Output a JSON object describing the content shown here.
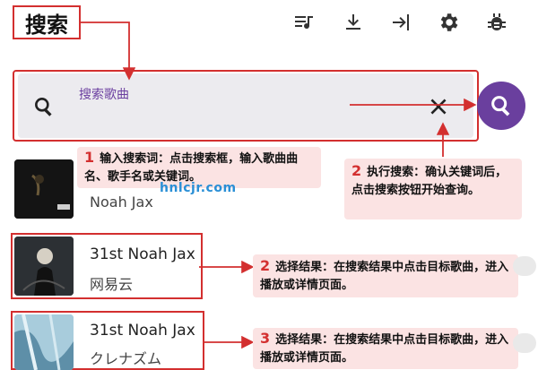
{
  "header": {
    "title": "搜索",
    "icons": [
      "playlist-icon",
      "download-icon",
      "login-icon",
      "gear-icon",
      "bug-icon"
    ]
  },
  "search": {
    "placeholder": "搜索歌曲"
  },
  "callouts": {
    "c1": {
      "num": "1",
      "text": "输入搜索词：点击搜索框，输入歌曲曲名、歌手名或关键词。"
    },
    "c2": {
      "num": "2",
      "text": "执行搜索：确认关键词后，点击搜索按钮开始查询。"
    },
    "c3": {
      "num": "2",
      "text": "选择结果：在搜索结果中点击目标歌曲，进入播放或详情页面。"
    },
    "c4": {
      "num": "3",
      "text": "选择结果：在搜索结果中点击目标歌曲，进入播放或详情页面。"
    }
  },
  "results": [
    {
      "title": "",
      "artist": "Noah Jax"
    },
    {
      "title": "31st Noah Jax",
      "artist": "网易云"
    },
    {
      "title": "31st Noah Jax",
      "artist": "クレナズム"
    }
  ],
  "watermark": "hnlcjr.com",
  "colors": {
    "accent": "#d32f2f",
    "brand": "#6a3f9e",
    "callout_bg": "#fbe3e3"
  }
}
